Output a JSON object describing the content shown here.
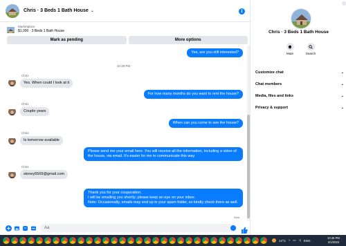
{
  "chat": {
    "title": "Chris · 3 Beds 1 Bath House",
    "listing_kicker": "Marketplace",
    "listing_price": "$1,000 · 3 Beds 1 Bath House",
    "mark_pending": "Mark as pending",
    "more_options": "More options",
    "composer_placeholder": "Aa"
  },
  "messages": {
    "out1": "Yes, are you still interested?",
    "time": "10:39 PM",
    "sender": "Chris",
    "in1": "Yes. When could I look at it",
    "out2": "For how many months do you want to rent the house?",
    "in2": "Couple years",
    "out3": "When can you come to see the house?",
    "in3": "Is tomorrow available",
    "out4": "Please send me your email here .You will receive all the information, including a video of the house, via email. It's easier for me to communicate this way",
    "in4": "stoney5569@gmail.com",
    "out5": "Thank you for your cooperation.\nI will be emailing you shortly; please keep an eye on your inbox.\nNote: Occasionally, emails may end up in your spam folder, so kindly check there as well.",
    "sent": "Sent"
  },
  "side": {
    "name": "Chris · 3 Beds 1 Bath House",
    "mute": "Mute",
    "search": "Search",
    "menu": [
      "Customize chat",
      "Chat members",
      "Media, files and links",
      "Privacy & support"
    ]
  },
  "taskbar": {
    "temp": "14°C",
    "lang": "ENG",
    "time": "10:45 PM",
    "date": "2/1/2023"
  },
  "colors": {
    "accent": "#0a7cff",
    "incoming": "#e4e6eb",
    "taskbar": "#1f2a3a"
  }
}
